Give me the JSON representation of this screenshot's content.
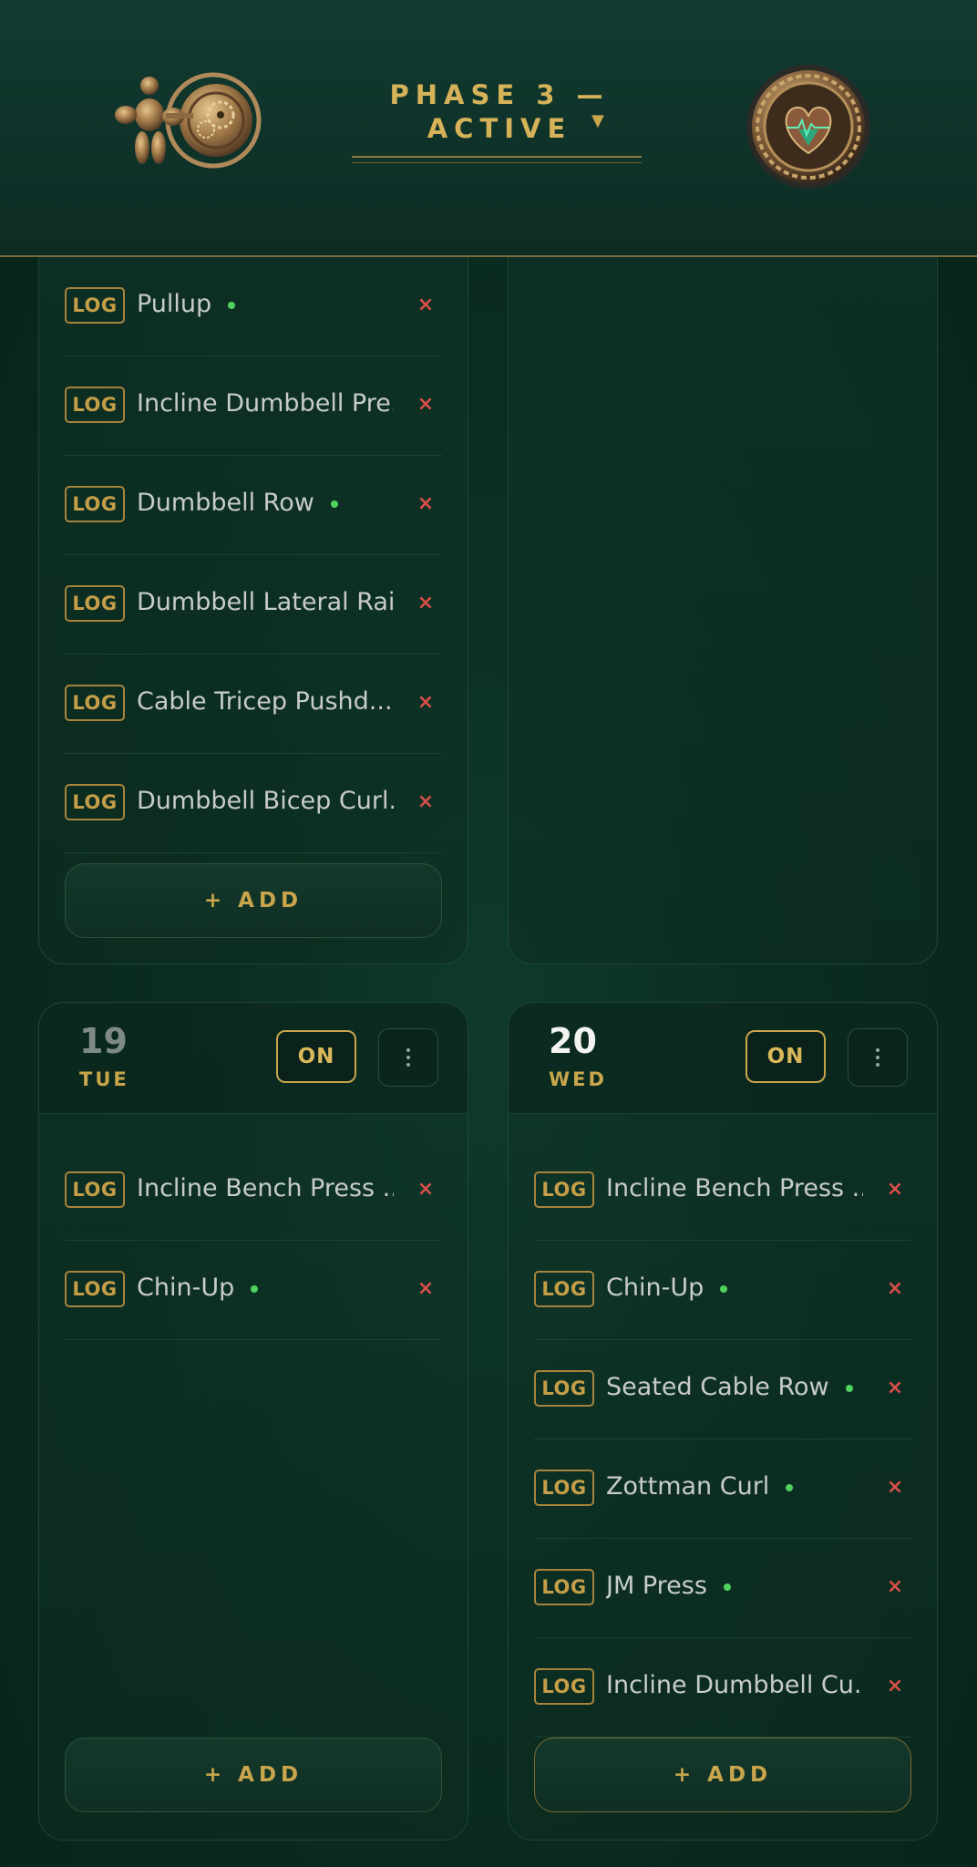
{
  "header": {
    "phase_label": "PHASE 3 — ACTIVE",
    "phase_caret": "▼",
    "left_logo": "steampunk-muscle-gear-logo",
    "right_logo": "steampunk-heart-gear-emblem"
  },
  "colors": {
    "gold": "#c9a54c",
    "green_dot": "#4fd35d",
    "red_x": "#d94f4a",
    "background": "#0b2c20"
  },
  "cards": {
    "top_left": {
      "exercises": [
        {
          "name": "Pullup",
          "logged": true
        },
        {
          "name": "Incline Dumbbell Pre...",
          "logged": false
        },
        {
          "name": "Dumbbell Row",
          "logged": true
        },
        {
          "name": "Dumbbell Lateral Rai...",
          "logged": false
        },
        {
          "name": "Cable Tricep Pushd...",
          "logged": false
        },
        {
          "name": "Dumbbell Bicep Curl...",
          "logged": false
        }
      ],
      "add_label": "+ ADD"
    },
    "tue": {
      "day_num": "19",
      "day_name": "TUE",
      "status": "ON",
      "exercises": [
        {
          "name": "Incline Bench Press ...",
          "logged": false
        },
        {
          "name": "Chin-Up",
          "logged": true
        }
      ],
      "add_label": "+ ADD"
    },
    "wed": {
      "day_num": "20",
      "day_name": "WED",
      "status": "ON",
      "exercises": [
        {
          "name": "Incline Bench Press ...",
          "logged": false
        },
        {
          "name": "Chin-Up",
          "logged": true
        },
        {
          "name": "Seated Cable Row",
          "logged": true
        },
        {
          "name": "Zottman Curl",
          "logged": true
        },
        {
          "name": "JM Press",
          "logged": true
        },
        {
          "name": "Incline Dumbbell Cu...",
          "logged": false
        }
      ],
      "add_label": "+ ADD"
    }
  },
  "labels": {
    "log": "LOG",
    "remove": "×"
  }
}
